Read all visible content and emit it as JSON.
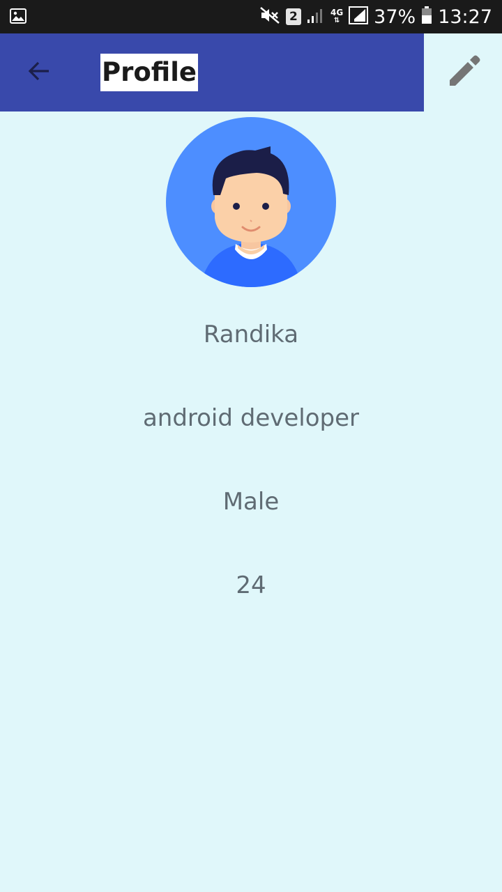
{
  "status_bar": {
    "left_icon": "gallery-icon",
    "sim_slot": "2",
    "network_type": "4G",
    "battery_percent": "37%",
    "time": "13:27",
    "icons": [
      "mute-icon",
      "sim-badge",
      "signal-icon",
      "network-type",
      "signal-full-icon",
      "battery-icon"
    ]
  },
  "app_bar": {
    "title": "Profile",
    "back_icon": "arrow-back-icon",
    "edit_icon": "pencil-icon",
    "color": "#3949AB"
  },
  "profile": {
    "name": "Randika",
    "occupation": "android developer",
    "gender": "Male",
    "age": "24"
  },
  "colors": {
    "background": "#E0F7FA",
    "avatar_bg": "#4D8EFF",
    "text": "#5F6B73"
  }
}
